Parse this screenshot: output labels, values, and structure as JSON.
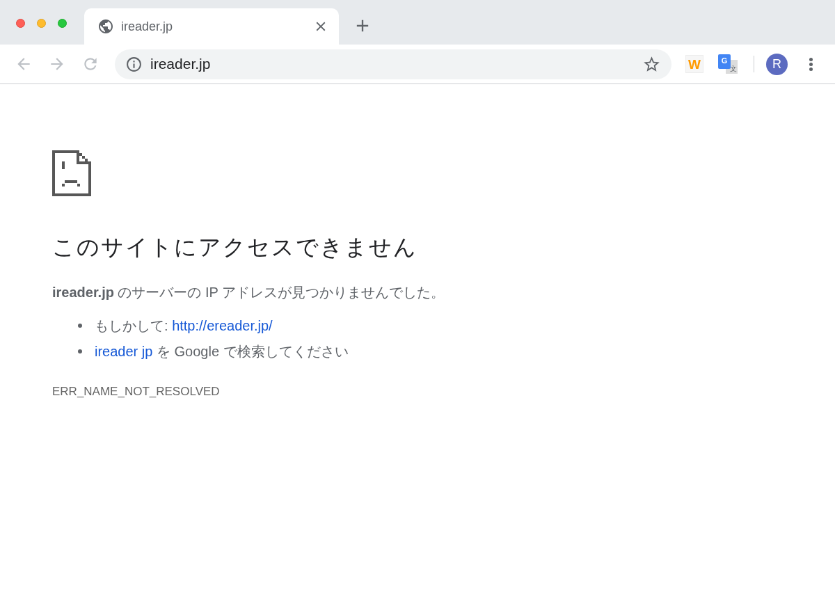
{
  "tabs": [
    {
      "title": "ireader.jp",
      "selected": true
    }
  ],
  "toolbar": {
    "nav_buttons": [
      {
        "kind": "back",
        "disabled": true
      },
      {
        "kind": "forward",
        "disabled": true
      },
      {
        "kind": "reload",
        "disabled": true
      }
    ],
    "address": "ireader.jp",
    "extensions": [
      {
        "kind": "letter_tile",
        "label": "W"
      },
      {
        "kind": "translate",
        "label": "G",
        "sublabel": "文"
      }
    ],
    "avatar": "R"
  },
  "error": {
    "title": "このサイトにアクセスできません",
    "message": "**ireader.jp** のサーバーの IP アドレスが見つかりませんでした。",
    "suggestions": [
      {
        "kind": "did_you_mean",
        "text": "もしかして:",
        "link": "http://ereader.jp/"
      },
      {
        "kind": "search",
        "link": "ireader jp",
        "text": "を Google で検索してください"
      }
    ],
    "code": "ERR_NAME_NOT_RESOLVED"
  }
}
